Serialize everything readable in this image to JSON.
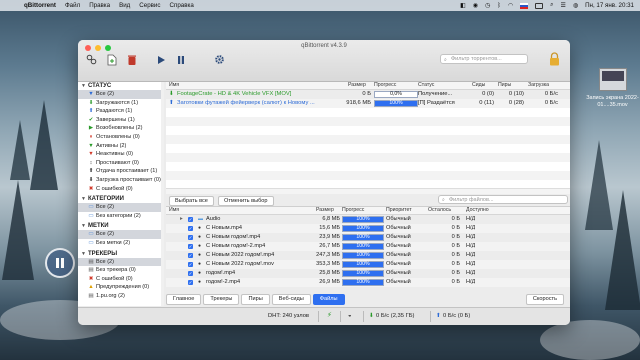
{
  "menubar": {
    "app": "qBittorrent",
    "items": [
      "Файл",
      "Правка",
      "Вид",
      "Сервис",
      "Справка"
    ],
    "datetime": "Пн, 17 янв.  20:31"
  },
  "window": {
    "title": "qBittorrent v4.3.9",
    "filter_placeholder": "Фильтр торрентов..."
  },
  "sidebar": {
    "status_header": "СТАТУС",
    "status": [
      {
        "label": "Все (2)",
        "icon": "filter-icon",
        "color": "#2d6bd6",
        "glyph": "▼"
      },
      {
        "label": "Загружаются (1)",
        "icon": "download-icon",
        "color": "#2a9a2a",
        "glyph": "⬇"
      },
      {
        "label": "Раздаются (1)",
        "icon": "upload-icon",
        "color": "#2d6bd6",
        "glyph": "⬆"
      },
      {
        "label": "Завершены (1)",
        "icon": "check-icon",
        "color": "#2a9a2a",
        "glyph": "✔"
      },
      {
        "label": "Возобновлены (2)",
        "icon": "play-icon",
        "color": "#2a9a2a",
        "glyph": "▶"
      },
      {
        "label": "Остановлены (0)",
        "icon": "pause-icon",
        "color": "#d23a2a",
        "glyph": "⏸"
      },
      {
        "label": "Активны (2)",
        "icon": "filter-active-icon",
        "color": "#2a9a2a",
        "glyph": "▼"
      },
      {
        "label": "Неактивны (0)",
        "icon": "filter-inactive-icon",
        "color": "#d23a2a",
        "glyph": "▼"
      },
      {
        "label": "Простаивают (0)",
        "icon": "stalled-icon",
        "color": "#333",
        "glyph": "↕"
      },
      {
        "label": "Отдача простаивает (1)",
        "icon": "stalled-upload-icon",
        "color": "#333",
        "glyph": "⬆"
      },
      {
        "label": "Загрузка простаивает (0)",
        "icon": "stalled-download-icon",
        "color": "#333",
        "glyph": "⬇"
      },
      {
        "label": "С ошибкой (0)",
        "icon": "error-icon",
        "color": "#d23a2a",
        "glyph": "✖"
      }
    ],
    "categories_header": "КАТЕГОРИИ",
    "categories": [
      {
        "label": "Все (2)",
        "icon": "folder-icon"
      },
      {
        "label": "Без категории (2)",
        "icon": "folder-icon"
      }
    ],
    "tags_header": "МЕТКИ",
    "tags": [
      {
        "label": "Все (2)",
        "icon": "folder-icon"
      },
      {
        "label": "Без метки (2)",
        "icon": "folder-icon"
      }
    ],
    "trackers_header": "ТРЕКЕРЫ",
    "trackers": [
      {
        "label": "Все (2)",
        "icon": "trackers-icon",
        "glyph": "▤",
        "color": "#555"
      },
      {
        "label": "Без трекера (0)",
        "icon": "no-tracker-icon",
        "glyph": "▤",
        "color": "#555"
      },
      {
        "label": "С ошибкой (0)",
        "icon": "tracker-error-icon",
        "glyph": "✖",
        "color": "#d23a2a"
      },
      {
        "label": "Предупреждения (0)",
        "icon": "warning-icon",
        "glyph": "▲",
        "color": "#e0a000"
      },
      {
        "label": "1.pu.org (2)",
        "icon": "tracker-host-icon",
        "glyph": "▤",
        "color": "#555"
      }
    ]
  },
  "torrents": {
    "columns": [
      "Имя",
      "Размер",
      "Прогресс",
      "Статус",
      "Сиды",
      "Пиры",
      "Загрузка"
    ],
    "rows": [
      {
        "icon": "download-arrow-icon",
        "name": "FootageCrate - HD & 4K Vehicle VFX [MOV]",
        "size": "0 Б",
        "progress": "0,0%",
        "progress_value": 0,
        "status": "Получение...",
        "seeds": "0 (0)",
        "peers": "0 (10)",
        "dl": "0 Б/с",
        "name_color": "#2a9a2a"
      },
      {
        "icon": "upload-arrow-icon",
        "name": "Заготовки футажей фейерверк (салют) к Новому ...",
        "size": "918,6 МБ",
        "progress": "100%",
        "progress_value": 100,
        "status": "[П] Раздаётся",
        "seeds": "0 (11)",
        "peers": "0 (28)",
        "dl": "0 Б/с",
        "name_color": "#2d6bd6"
      }
    ]
  },
  "files_panel": {
    "select_all": "Выбрать все",
    "deselect": "Отменить выбор",
    "filter_placeholder": "Фильтр файлов...",
    "columns": [
      "Имя",
      "Размер",
      "Прогресс",
      "Приоритет",
      "Осталось",
      "Доступно"
    ],
    "rows": [
      {
        "name": "Audio",
        "folder": true,
        "size": "6,8 МБ",
        "progress": "100%",
        "priority": "Обычный",
        "remaining": "0 Б",
        "available": "Н/Д"
      },
      {
        "name": "С Новым.mp4",
        "folder": false,
        "size": "15,6 МБ",
        "progress": "100%",
        "priority": "Обычный",
        "remaining": "0 Б",
        "available": "Н/Д"
      },
      {
        "name": "С Новым годом!.mp4",
        "folder": false,
        "size": "23,9 МБ",
        "progress": "100%",
        "priority": "Обычный",
        "remaining": "0 Б",
        "available": "Н/Д"
      },
      {
        "name": "С Новым годом!-2.mp4",
        "folder": false,
        "size": "26,7 МБ",
        "progress": "100%",
        "priority": "Обычный",
        "remaining": "0 Б",
        "available": "Н/Д"
      },
      {
        "name": "С Новым 2022 годом!.mp4",
        "folder": false,
        "size": "247,3 МБ",
        "progress": "100%",
        "priority": "Обычный",
        "remaining": "0 Б",
        "available": "Н/Д"
      },
      {
        "name": "С Новым 2022 годом!.mov",
        "folder": false,
        "size": "353,3 МБ",
        "progress": "100%",
        "priority": "Обычный",
        "remaining": "0 Б",
        "available": "Н/Д"
      },
      {
        "name": "годом!.mp4",
        "folder": false,
        "size": "25,8 МБ",
        "progress": "100%",
        "priority": "Обычный",
        "remaining": "0 Б",
        "available": "Н/Д"
      },
      {
        "name": "годом!-2.mp4",
        "folder": false,
        "size": "26,9 МБ",
        "progress": "100%",
        "priority": "Обычный",
        "remaining": "0 Б",
        "available": "Н/Д"
      }
    ]
  },
  "tabs": [
    "Главное",
    "Трекеры",
    "Пиры",
    "Веб-сиды",
    "Файлы"
  ],
  "active_tab": "Файлы",
  "speed_button": "Скорость",
  "statusbar": {
    "dht": "DHT: 240 узлов",
    "download": "0 Б/с (2,35 ГБ)",
    "upload": "0 Б/с (0 Б)"
  },
  "desktop": {
    "screenshot_label": "Запись экрана 2022-01....35.mov"
  },
  "colors": {
    "accent": "#2e6ff0",
    "close": "#ff5f57",
    "minimize": "#febc2e",
    "zoom": "#28c840"
  }
}
